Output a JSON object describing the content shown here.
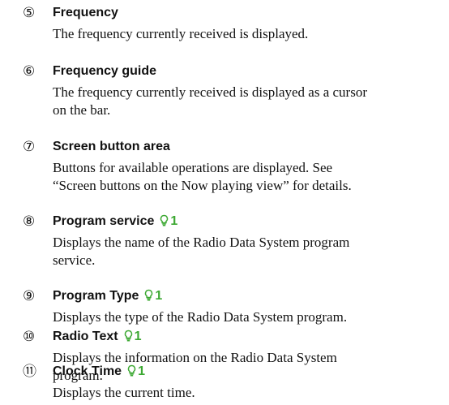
{
  "items": [
    {
      "num": "⑤",
      "title": "Frequency",
      "badge": "",
      "lines": [
        "The frequency currently received is displayed."
      ]
    },
    {
      "num": "⑥",
      "title": "Frequency guide",
      "badge": "",
      "lines": [
        "The frequency currently received is displayed as a cursor",
        "on the bar."
      ]
    },
    {
      "num": "⑦",
      "title": "Screen button area",
      "badge": "",
      "lines": [
        "Buttons for available operations are displayed. See",
        "“Screen buttons on the Now playing view” for details."
      ]
    },
    {
      "num": "⑧",
      "title": "Program service",
      "badge": "1",
      "lines": [
        "Displays the name of the Radio Data System program",
        "service."
      ]
    },
    {
      "num": "⑨",
      "title": "Program Type",
      "badge": "1",
      "lines": [
        "Displays the type of the Radio Data System program."
      ]
    },
    {
      "num": "⑩",
      "title": "Radio Text",
      "badge": "1",
      "lines": [
        "Displays the information on the Radio Data System",
        "program."
      ]
    },
    {
      "num": "⑪",
      "title": "Clock Time",
      "badge": "1",
      "lines": [
        "Displays the current time."
      ]
    }
  ],
  "icons": {
    "badge_icon": "lightbulb-note-icon",
    "badge_color": "#3ca832"
  }
}
